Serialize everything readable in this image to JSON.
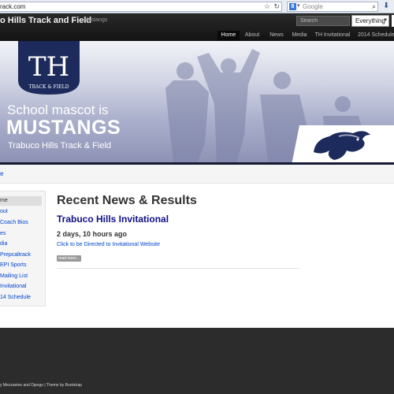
{
  "browser": {
    "url": "rack.com",
    "search_placeholder": "Google",
    "search_engine_icon": "8"
  },
  "navbar": {
    "title": "o Hills Track and Field",
    "tagline": "Mustangs",
    "search_placeholder": "Search",
    "scope_select": "Everything",
    "links": [
      "Home",
      "About",
      "News",
      "Media",
      "TH Invitational",
      "2014 Schedule"
    ],
    "active_link": "Home"
  },
  "hero": {
    "crest_letters": "TH",
    "crest_caption": "TRACK & FIELD",
    "mascot_line": "School mascot is",
    "mascot_name": "MUSTANGS",
    "subtitle": "Trabuco Hills Track & Field"
  },
  "breadcrumb": {
    "current": "e"
  },
  "sidebar": {
    "items": [
      "me",
      "out",
      "Coach Bios",
      "es",
      "dia",
      "Prepcaltrack",
      "EPI Sports",
      "Mailing List",
      "Invitational",
      "14 Schedule"
    ],
    "active_index": 0
  },
  "main": {
    "heading": "Recent News & Results",
    "post_title": "Trabuco Hills Invitational",
    "post_time": "2 days, 10 hours ago",
    "post_link": "Click to be Directed to Invitational Website",
    "read_more": "read more..."
  },
  "footer": {
    "text": "y Mezzanine and Django | Theme by Bootstrap"
  },
  "colors": {
    "navbar_bg": "#1c1c1c",
    "hero_top": "#f2f3f8",
    "hero_bottom": "#8c91b4",
    "crest_navy": "#1c2a5c",
    "link_blue": "#0044cc",
    "post_title_navy": "#0f0f87",
    "footer_bg": "#2c2c2c"
  }
}
